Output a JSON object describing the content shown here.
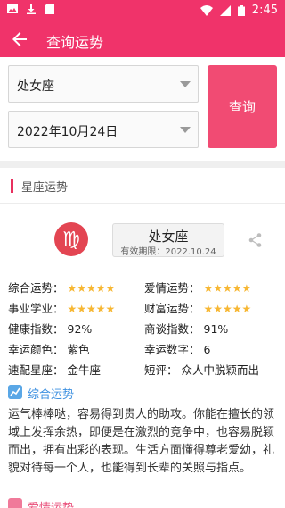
{
  "status_bar": {
    "time": "2:45"
  },
  "app_bar": {
    "title": "查询运势"
  },
  "query": {
    "sign_value": "处女座",
    "date_value": "2022年10月24日",
    "button_label": "查询"
  },
  "section": {
    "title": "星座运势"
  },
  "card": {
    "sign_name": "处女座",
    "valid": "有效期限：2022.10.24",
    "left_rows": [
      {
        "label": "综合运势：",
        "stars": 4,
        "stars_text": "★★★★"
      },
      {
        "label": "事业学业：",
        "stars": 4,
        "stars_text": "★★★★"
      },
      {
        "label": "健康指数：",
        "value": "92%"
      },
      {
        "label": "幸运颜色：",
        "value": "紫色"
      },
      {
        "label": "速配星座：",
        "value": "金牛座"
      }
    ],
    "right_rows": [
      {
        "label": "爱情运势：",
        "stars": 5,
        "stars_text": "★★★★★"
      },
      {
        "label": "财富运势：",
        "stars": 4,
        "stars_text": "★★★★"
      },
      {
        "label": "商谈指数：",
        "value": "91%"
      },
      {
        "label": "幸运数字：",
        "value": "6"
      },
      {
        "label": "短评：",
        "value": "众人中脱颖而出"
      }
    ],
    "overall_title": "综合运势",
    "overall_text": "运气棒棒哒，容易得到贵人的助攻。你能在擅长的领域上发挥余热，即便是在激烈的竞争中，也容易脱颖而出，拥有出彩的表现。生活方面懂得尊老爱幼，礼貌对待每一个人，也能得到长辈的关照与指点。",
    "love_title": "爱情运势"
  },
  "colors": {
    "primary": "#f0336a",
    "button": "#f14b73",
    "star": "#f7b733",
    "link": "#3b8fe0"
  }
}
